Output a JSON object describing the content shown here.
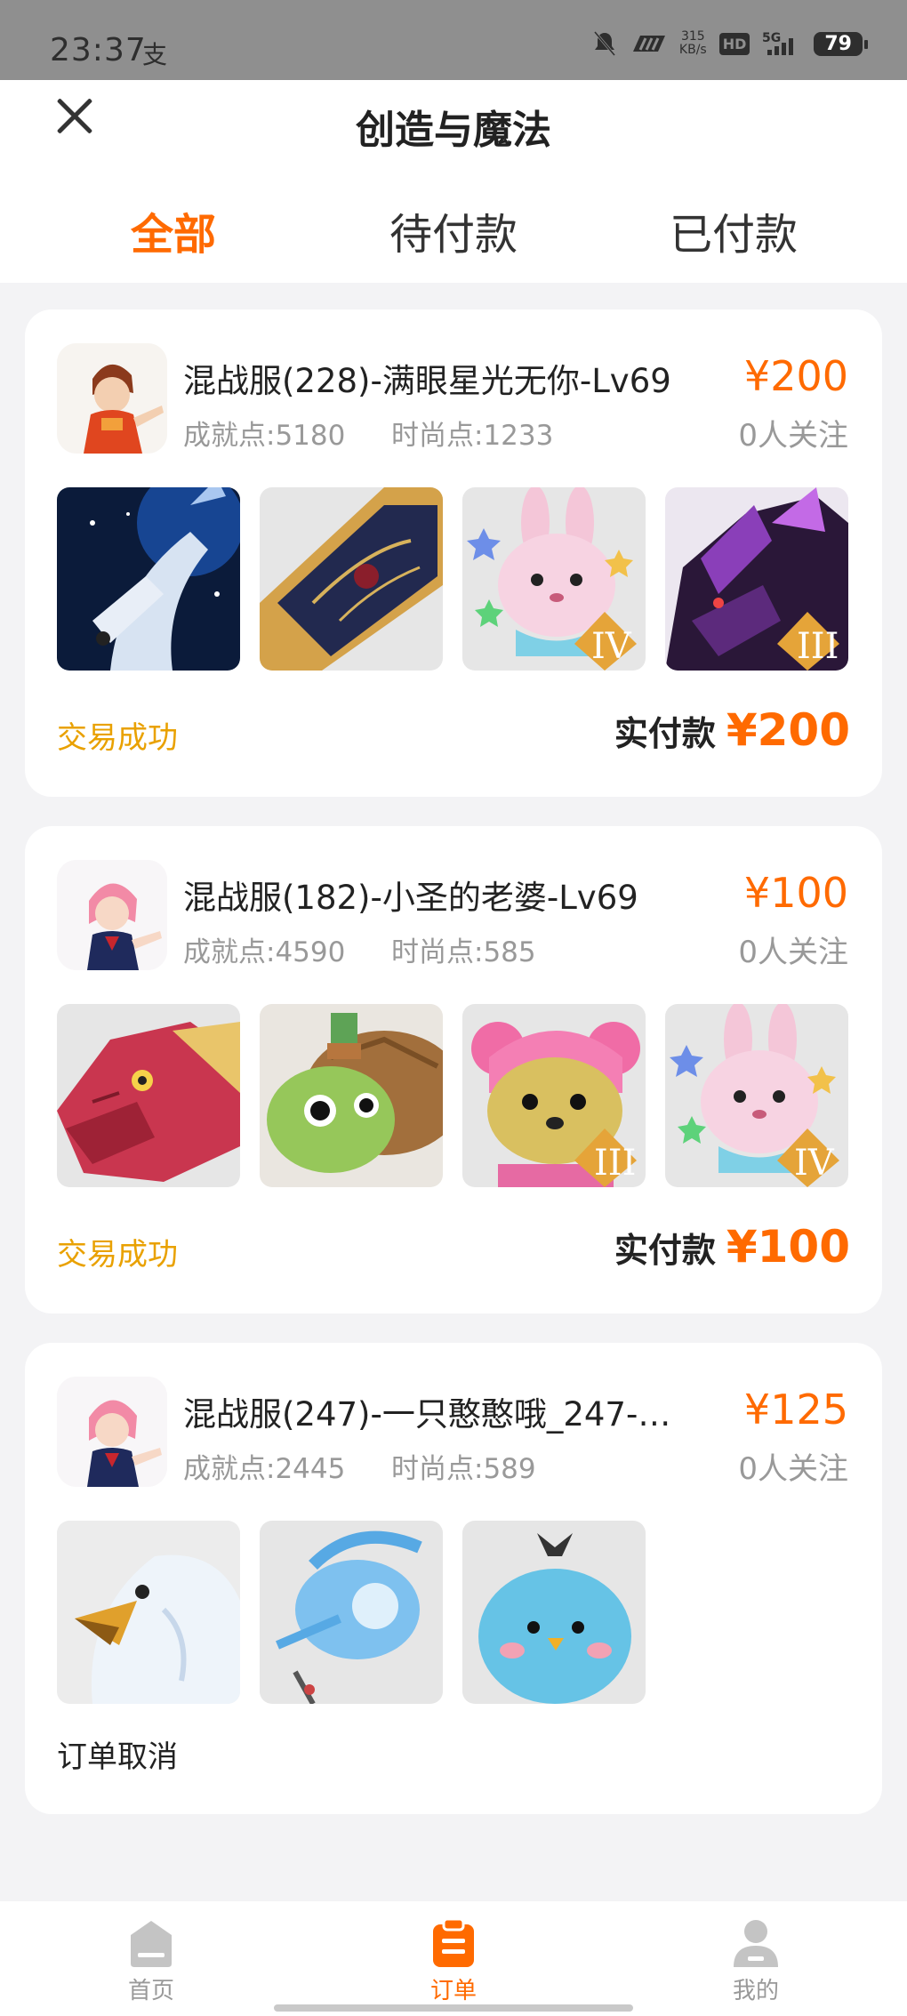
{
  "status_bar": {
    "time": "23:37",
    "speed_value": "315",
    "speed_unit": "KB/s",
    "hd": "HD",
    "network": "5G",
    "battery": "79"
  },
  "header": {
    "title": "创造与魔法",
    "close_icon": "close-icon"
  },
  "tabs": [
    {
      "label": "全部",
      "active": true
    },
    {
      "label": "待付款",
      "active": false
    },
    {
      "label": "已付款",
      "active": false
    }
  ],
  "orders": [
    {
      "title": "混战服(228)-满眼星光无你-Lv69",
      "achievement": "成就点:5180",
      "fashion": "时尚点:1233",
      "price": "¥200",
      "followers": "0人关注",
      "status": "交易成功",
      "paid_label": "实付款",
      "paid_amount": "¥200"
    },
    {
      "title": "混战服(182)-小圣的老婆-Lv69",
      "achievement": "成就点:4590",
      "fashion": "时尚点:585",
      "price": "¥100",
      "followers": "0人关注",
      "status": "交易成功",
      "paid_label": "实付款",
      "paid_amount": "¥100"
    },
    {
      "title": "混战服(247)-一只憨憨哦_247-…",
      "achievement": "成就点:2445",
      "fashion": "时尚点:589",
      "price": "¥125",
      "followers": "0人关注",
      "status": "订单取消"
    }
  ],
  "bottom_nav": [
    {
      "label": "首页",
      "icon": "home-icon"
    },
    {
      "label": "订单",
      "icon": "order-icon",
      "active": true
    },
    {
      "label": "我的",
      "icon": "user-icon"
    }
  ]
}
